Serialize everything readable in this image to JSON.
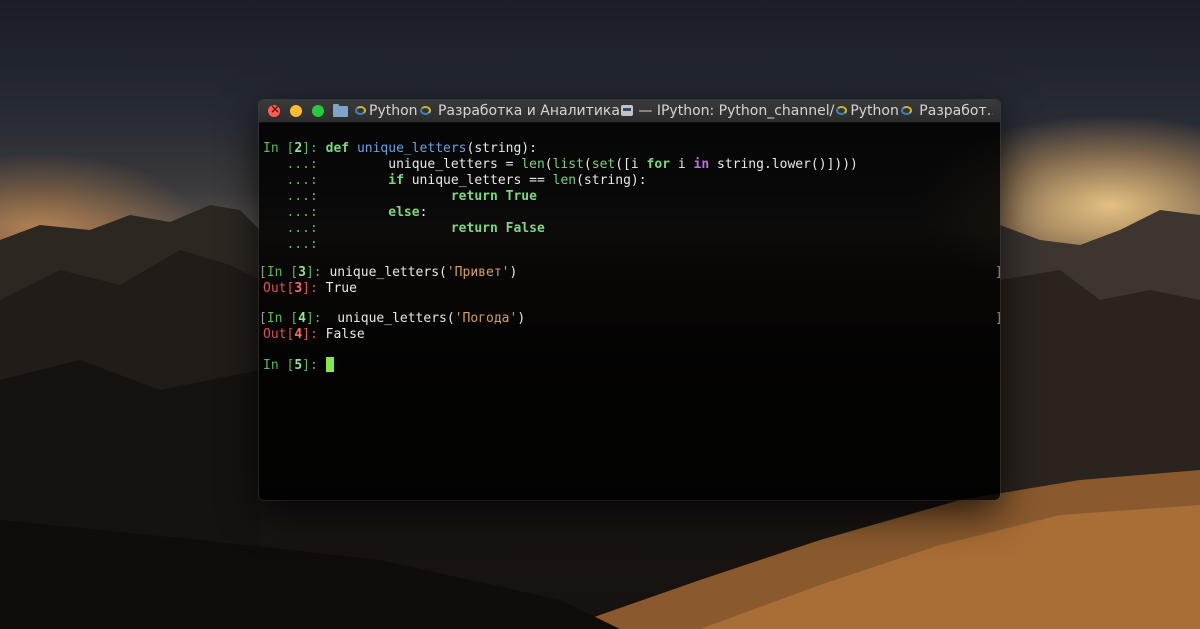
{
  "window": {
    "title_part1": "Python",
    "title_part2": " Разработка и Аналитика",
    "title_part3": " — IPython: Python_channel/",
    "title_part4": "Python",
    "title_part5": " Разработ…"
  },
  "cells": {
    "c2": {
      "prompt_label": "In [",
      "number": "2",
      "prompt_end": "]: ",
      "cont": "   ...: ",
      "l1_kw": "def",
      "l1_fn": "unique_letters",
      "l1_rest": "(string):",
      "l2_a": "        unique_letters = ",
      "l2_len": "len",
      "l2_b": "(",
      "l2_list": "list",
      "l2_c": "(",
      "l2_set": "set",
      "l2_d": "([i ",
      "l2_for": "for",
      "l2_e": " i ",
      "l2_in": "in",
      "l2_f": " string.lower()])))",
      "l3_a": "        ",
      "l3_if": "if",
      "l3_b": " unique_letters == ",
      "l3_len": "len",
      "l3_c": "(string):",
      "l4_a": "                ",
      "l4_ret": "return",
      "l4_sp": " ",
      "l4_val": "True",
      "l5_a": "        ",
      "l5_else": "else",
      "l5_b": ":",
      "l6_a": "                ",
      "l6_ret": "return",
      "l6_sp": " ",
      "l6_val": "False"
    },
    "c3": {
      "open": "[",
      "prompt_label": "In [",
      "number": "3",
      "prompt_end": "]: ",
      "code_a": "unique_letters(",
      "code_str": "'Привет'",
      "code_b": ")",
      "out_label": "Out[",
      "out_number": "3",
      "out_end": "]: ",
      "output": "True",
      "close": "]"
    },
    "c4": {
      "open": "[",
      "prompt_label": "In [",
      "number": "4",
      "prompt_end": "]: ",
      "code_a": " unique_letters(",
      "code_str": "'Погода'",
      "code_b": ")",
      "out_label": "Out[",
      "out_number": "4",
      "out_end": "]: ",
      "output": "False",
      "close": "]"
    },
    "c5": {
      "prompt_label": "In [",
      "number": "5",
      "prompt_end": "]: "
    }
  },
  "colors": {
    "prompt_in": "#5bb85b",
    "prompt_out": "#e0524a",
    "keyword": "#7dd87d",
    "keyword_in": "#c16fe0",
    "function": "#6f9fe8",
    "string": "#d69f62",
    "cursor": "#86e64f"
  }
}
